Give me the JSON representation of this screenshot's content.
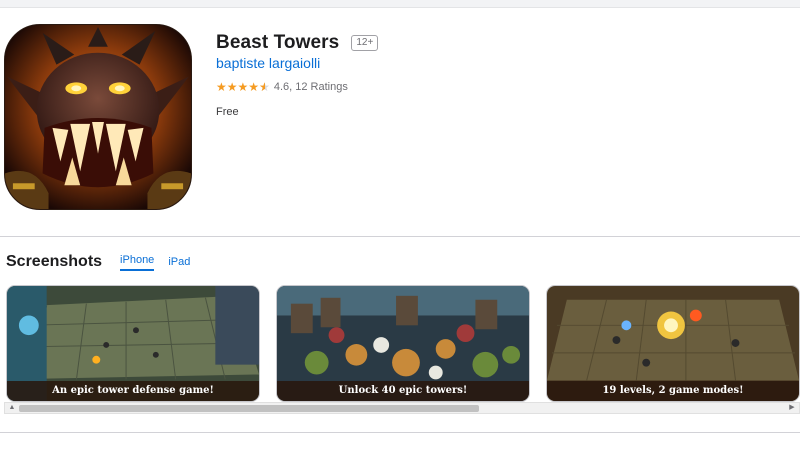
{
  "app": {
    "title": "Beast Towers",
    "age_rating": "12+",
    "developer": "baptiste largaiolli",
    "rating_value": 4.6,
    "rating_text": "4.6, 12 Ratings",
    "price": "Free",
    "icon": "beast-monster-app-icon"
  },
  "screenshots": {
    "title": "Screenshots",
    "tabs": [
      {
        "label": "iPhone",
        "active": true
      },
      {
        "label": "iPad",
        "active": false
      }
    ],
    "items": [
      {
        "caption": "An epic tower defense game!"
      },
      {
        "caption": "Unlock 40 epic towers!"
      },
      {
        "caption": "19 levels, 2 game modes!"
      }
    ],
    "scroll_position": 0.0,
    "scroll_visible_fraction": 0.6
  },
  "colors": {
    "link": "#0a6fd6",
    "star": "#f59b22",
    "text": "#1d1d1f",
    "muted": "#6e6e73"
  },
  "icons": {
    "scroll_left": "▲",
    "scroll_right": "▶"
  }
}
